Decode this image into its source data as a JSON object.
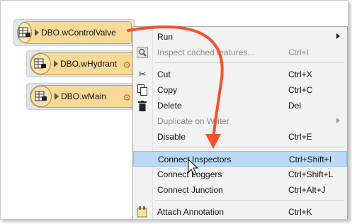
{
  "nodes": [
    {
      "name": "DBO.wControlValve"
    },
    {
      "name": "DBO.wHydrant"
    },
    {
      "name": "DBO.wMain"
    }
  ],
  "menu": {
    "items": [
      {
        "label": "Run",
        "shortcut": "",
        "submenu": true,
        "disabled": false,
        "icon": ""
      },
      {
        "label": "Inspect cached features...",
        "shortcut": "Ctrl+I",
        "submenu": false,
        "disabled": true,
        "icon": "magnifier-icon"
      },
      {
        "label": "Cut",
        "shortcut": "Ctrl+X",
        "submenu": false,
        "disabled": false,
        "icon": "scissors-icon"
      },
      {
        "label": "Copy",
        "shortcut": "Ctrl+C",
        "submenu": false,
        "disabled": false,
        "icon": "copy-icon"
      },
      {
        "label": "Delete",
        "shortcut": "Del",
        "submenu": false,
        "disabled": false,
        "icon": "trash-icon"
      },
      {
        "label": "Duplicate on Writer",
        "shortcut": "",
        "submenu": true,
        "disabled": true,
        "icon": ""
      },
      {
        "label": "Disable",
        "shortcut": "Ctrl+E",
        "submenu": false,
        "disabled": false,
        "icon": ""
      },
      {
        "label": "Connect Inspectors",
        "shortcut": "Ctrl+Shift+I",
        "submenu": false,
        "disabled": false,
        "icon": "",
        "highlighted": true
      },
      {
        "label": "Connect Loggers",
        "shortcut": "Ctrl+Shift+L",
        "submenu": false,
        "disabled": false,
        "icon": ""
      },
      {
        "label": "Connect Junction",
        "shortcut": "Ctrl+Alt+J",
        "submenu": false,
        "disabled": false,
        "icon": ""
      },
      {
        "label": "Attach Annotation",
        "shortcut": "Ctrl+K",
        "submenu": false,
        "disabled": false,
        "icon": "annotation-icon"
      }
    ]
  },
  "colors": {
    "callout_arrow": "#f4522d",
    "highlight": "#b9d9f4",
    "node_fill": "#f8d997"
  }
}
